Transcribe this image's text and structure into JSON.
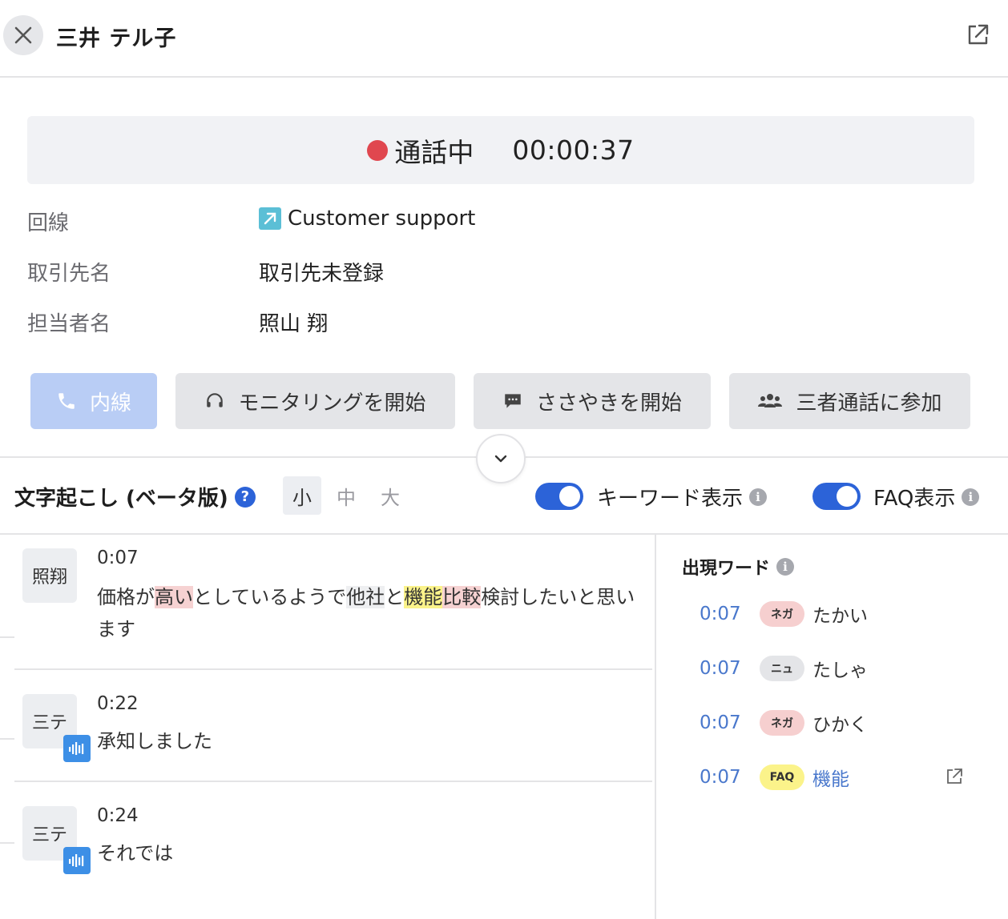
{
  "header": {
    "title": "三井 テル子"
  },
  "call": {
    "status": "通話中",
    "timer": "00:00:37",
    "status_color": "#e0474f"
  },
  "info": {
    "line_label": "回線",
    "line_value": "Customer support",
    "client_label": "取引先名",
    "client_value": "取引先未登録",
    "agent_label": "担当者名",
    "agent_value": "照山 翔"
  },
  "actions": {
    "naisen": "内線",
    "monitoring": "モニタリングを開始",
    "whisper": "ささやきを開始",
    "threeway": "三者通話に参加"
  },
  "transcript": {
    "title": "文字起こし (ベータ版)",
    "sizes": [
      "小",
      "中",
      "大"
    ],
    "keyword_toggle": "キーワード表示",
    "faq_toggle": "FAQ表示",
    "accent_color": "#2c63d8",
    "entries": [
      {
        "avatar": "照翔",
        "time": "0:07",
        "segments": [
          "価格が",
          "高い",
          "としているようで",
          "他社",
          "と",
          "機能",
          "比較",
          "検討したいと思います"
        ]
      },
      {
        "avatar": "三テ",
        "time": "0:22",
        "text": "承知しました"
      },
      {
        "avatar": "三テ",
        "time": "0:24",
        "text": "それでは"
      }
    ]
  },
  "words": {
    "title": "出現ワード",
    "items": [
      {
        "time": "0:07",
        "badge": "ネガ",
        "word": "たかい"
      },
      {
        "time": "0:07",
        "badge": "ニュ",
        "word": "たしゃ"
      },
      {
        "time": "0:07",
        "badge": "ネガ",
        "word": "ひかく"
      },
      {
        "time": "0:07",
        "badge": "FAQ",
        "word": "機能"
      }
    ]
  }
}
